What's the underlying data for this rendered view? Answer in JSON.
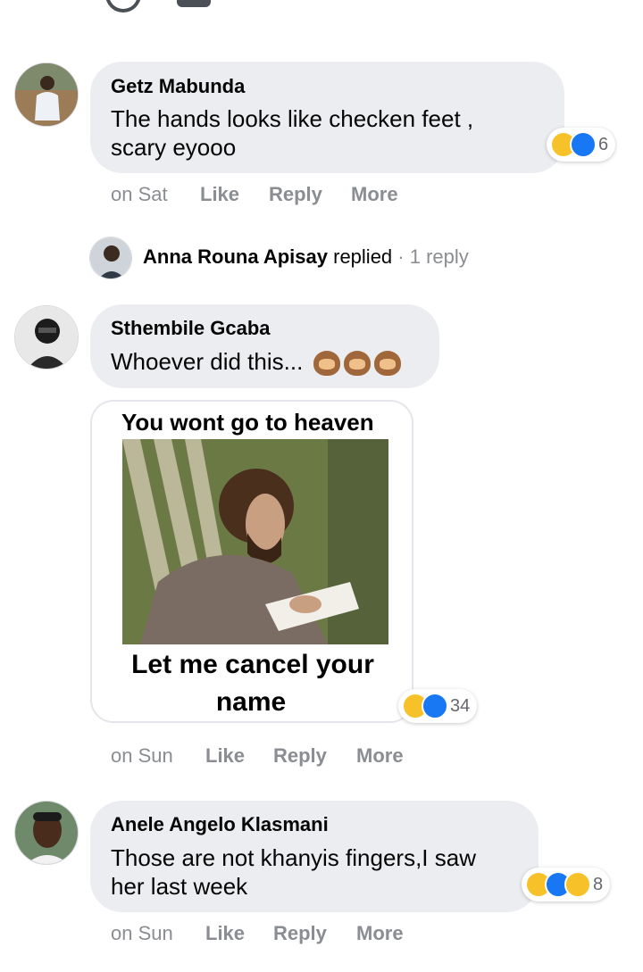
{
  "comments": [
    {
      "author": "Getz Mabunda",
      "text_line1": "The hands looks like checken feet ,",
      "text_line2": "scary eyooo",
      "time": "on Sat",
      "like": "Like",
      "reply": "Reply",
      "more": "More",
      "reaction_count": "6",
      "reactions": [
        "haha-icon",
        "like-icon"
      ]
    },
    {
      "author": "Sthembile Gcaba",
      "text_line1": "Whoever did this...",
      "emoji": [
        "see-no-evil-monkey",
        "see-no-evil-monkey",
        "see-no-evil-monkey"
      ],
      "meme_top": "You wont go to heaven",
      "meme_bottom_line1": "Let me cancel your",
      "meme_bottom_line2": "name",
      "time": "on Sun",
      "like": "Like",
      "reply": "Reply",
      "more": "More",
      "reaction_count": "34",
      "reactions": [
        "haha-icon",
        "like-icon"
      ]
    },
    {
      "author": "Anele Angelo Klasmani",
      "text_line1": "Those are not khanyis fingers,I saw",
      "text_line2": "her last week",
      "time": "on Sun",
      "like": "Like",
      "reply": "Reply",
      "more": "More",
      "reaction_count": "8",
      "reactions": [
        "haha-icon",
        "like-icon",
        "care-icon"
      ]
    }
  ],
  "reply_summary": {
    "name": "Anna Rouna Apisay",
    "action": "replied",
    "separator": "·",
    "count": "1 reply"
  },
  "colors": {
    "bubble": "#ebedf0",
    "meta": "#8a8d91",
    "like_blue": "#1877f2",
    "haha_yellow": "#f7c229"
  }
}
